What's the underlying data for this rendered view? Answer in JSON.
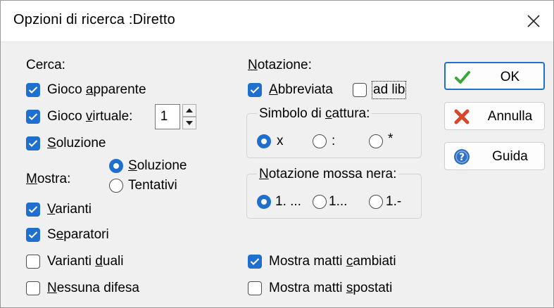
{
  "dialog": {
    "title": "Opzioni di ricerca :Diretto",
    "close_icon": "close-icon"
  },
  "cerca": {
    "label": "Cerca:",
    "gioco_apparente": {
      "pre": "Gioco ",
      "key": "a",
      "post": "pparente",
      "checked": true
    },
    "gioco_virtuale": {
      "pre": "Gioco ",
      "key": "v",
      "post": "irtuale:",
      "checked": true,
      "value": "1"
    },
    "soluzione": {
      "pre": "",
      "key": "S",
      "post": "oluzione",
      "checked": true
    }
  },
  "mostra": {
    "label_key": "M",
    "label_rest": "ostra:",
    "options": [
      {
        "pre": "",
        "key": "S",
        "post": "oluzione",
        "selected": true
      },
      {
        "pre": "Tentativi",
        "key": "",
        "post": "",
        "selected": false
      }
    ]
  },
  "varianti": {
    "pre": "",
    "key": "V",
    "post": "arianti",
    "checked": true
  },
  "separatori": {
    "pre": "S",
    "key": "e",
    "post": "paratori",
    "checked": true
  },
  "varianti_duali": {
    "pre": "Varianti ",
    "key": "d",
    "post": "uali",
    "checked": false
  },
  "nessuna_difesa": {
    "pre": "",
    "key": "N",
    "post": "essuna difesa",
    "checked": false
  },
  "notazione": {
    "label_key": "N",
    "label_rest": "otazione:",
    "abbreviata": {
      "pre": "",
      "key": "A",
      "post": "bbreviata",
      "checked": true
    },
    "ad_lib": {
      "label": "ad lib",
      "checked": false
    }
  },
  "simbolo_cattura": {
    "label_pre": "Simbolo di ",
    "label_key": "c",
    "label_post": "attura:",
    "options": [
      {
        "label": "x",
        "selected": true
      },
      {
        "label": ":",
        "selected": false
      },
      {
        "label": "*",
        "selected": false
      }
    ]
  },
  "notazione_nera": {
    "label_pre": "",
    "label_key": "N",
    "label_post": "otazione mossa nera:",
    "options": [
      {
        "label": "1. ...",
        "selected": true
      },
      {
        "label": "1...",
        "selected": false
      },
      {
        "label": "1.-",
        "selected": false
      }
    ]
  },
  "mostra_matti_cambiati": {
    "pre": "Mostra matti ",
    "key": "c",
    "post": "ambiati",
    "checked": true
  },
  "mostra_matti_spostati": {
    "pre": "Mostra matti ",
    "key": "s",
    "post": "postati",
    "checked": false
  },
  "buttons": {
    "ok": {
      "label": "OK",
      "icon": "checkmark-icon"
    },
    "annulla": {
      "label": "Annulla",
      "icon": "red-x-icon"
    },
    "guida": {
      "label": "Guida",
      "icon": "help-icon"
    }
  },
  "colors": {
    "accent": "#1f6fcf",
    "dialog_bg": "#f0f0f0",
    "ok_green": "#3aa53a",
    "cancel_red": "#d9472b",
    "help_blue": "#2f6fc4"
  }
}
